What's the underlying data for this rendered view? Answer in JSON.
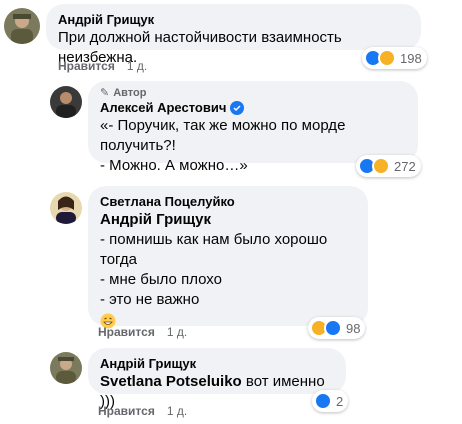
{
  "comments": [
    {
      "author": "Андрій Грищук",
      "text": "При должной настойчивости взаимность неизбежна.",
      "like_label": "Нравится",
      "time": "1 д.",
      "reaction_count": "198"
    },
    {
      "author_tag": "Автор",
      "author": "Алексей Арестович",
      "lines": [
        "«- Поручик, так же можно по морде получить?!",
        "- Можно. А можно…»"
      ],
      "reaction_count": "272"
    },
    {
      "author": "Светлана Поцелуйко",
      "mention": "Андрій Грищук",
      "lines": [
        "- помнишь как нам было хорошо тогда",
        "- мне было плохо",
        "- это не важно"
      ],
      "emoji": "grinning-emoji",
      "like_label": "Нравится",
      "time": "1 д.",
      "reaction_count": "98"
    },
    {
      "author": "Андрій Грищук",
      "mention": "Svetlana Potseluiko",
      "text": "вот именно )))",
      "like_label": "Нравится",
      "time": "1 д.",
      "reaction_count": "2"
    }
  ],
  "colors": {
    "bubble": "#f0f2f5",
    "like_blue": "#1877f2",
    "haha_yellow": "#f7b125",
    "meta_gray": "#65676b"
  }
}
